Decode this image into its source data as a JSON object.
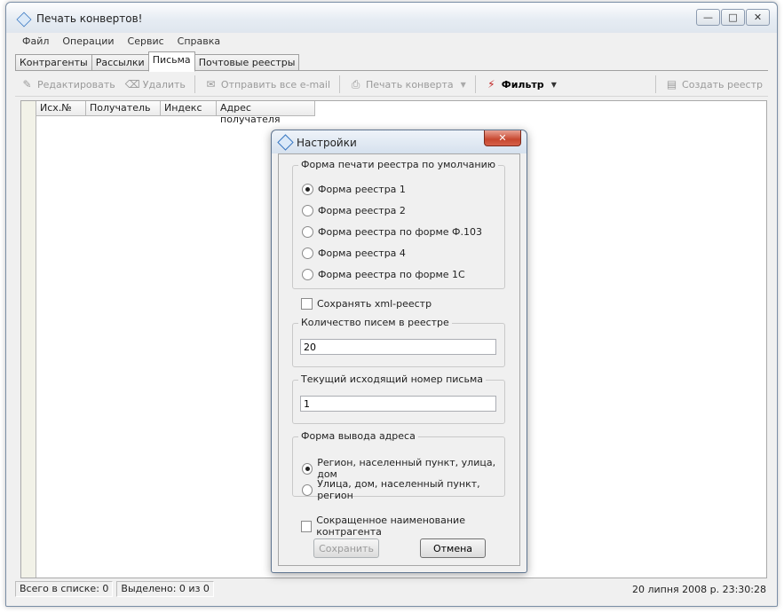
{
  "window": {
    "title": "Печать конвертов!"
  },
  "menu": [
    "Файл",
    "Операции",
    "Сервис",
    "Справка"
  ],
  "tabs": [
    "Контрагенты",
    "Рассылки",
    "Письма",
    "Почтовые реестры"
  ],
  "active_tab": 2,
  "toolbar": {
    "edit": "Редактировать",
    "delete": "Удалить",
    "send_all": "Отправить все e-mail",
    "print": "Печать конверта",
    "filter": "Фильтр",
    "create_registry": "Создать реестр"
  },
  "grid": {
    "columns": [
      "Исх.№",
      "Получатель",
      "Индекс",
      "Адрес получателя"
    ]
  },
  "status": {
    "total": "Всего в списке: 0",
    "selected": "Выделено: 0 из 0",
    "datetime": "20 липня 2008 р. 23:30:28"
  },
  "dialog": {
    "title": "Настройки",
    "print_form_group": "Форма печати реестра по умолчанию",
    "print_forms": [
      "Форма реестра 1",
      "Форма реестра 2",
      "Форма реестра по форме Ф.103",
      "Форма реестра 4",
      "Форма реестра по форме 1С"
    ],
    "print_form_selected": 0,
    "save_xml": "Сохранять xml-реестр",
    "save_xml_checked": false,
    "letters_count_group": "Количество писем в реестре",
    "letters_count": "20",
    "current_number_group": "Текущий исходящий номер письма",
    "current_number": "1",
    "address_form_group": "Форма вывода адреса",
    "address_forms": [
      "Регион, населенный пункт, улица, дом",
      "Улица, дом, населенный пункт, регион"
    ],
    "address_form_selected": 0,
    "short_name": "Сокращенное наименование контрагента",
    "short_name_checked": false,
    "save_button": "Сохранить",
    "cancel_button": "Отмена"
  }
}
